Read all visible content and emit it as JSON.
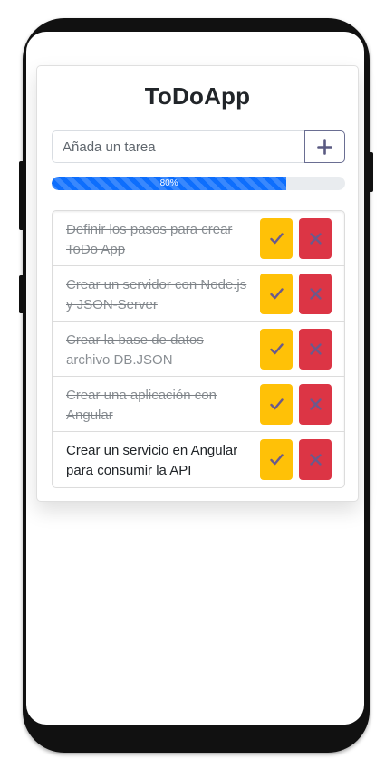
{
  "app": {
    "title": "ToDoApp"
  },
  "input": {
    "placeholder": "Añada un tarea",
    "add_icon": "plus-icon"
  },
  "progress": {
    "value": 80,
    "label": "80%"
  },
  "tasks": [
    {
      "text": "Definir los pasos para crear ToDo App",
      "done": true
    },
    {
      "text": "Crear un servidor con Node.js y JSON-Server",
      "done": true
    },
    {
      "text": "Crear la base de datos archivo DB.JSON",
      "done": true
    },
    {
      "text": "Crear una aplicación con Angular",
      "done": true
    },
    {
      "text": "Crear un servicio en Angular para consumir la API",
      "done": false
    }
  ],
  "icons": {
    "check": "check-icon",
    "delete": "close-icon"
  },
  "colors": {
    "accent": "#0d6efd",
    "check_button": "#ffc107",
    "delete_button": "#dc3545",
    "icon": "#6a5a8c"
  }
}
